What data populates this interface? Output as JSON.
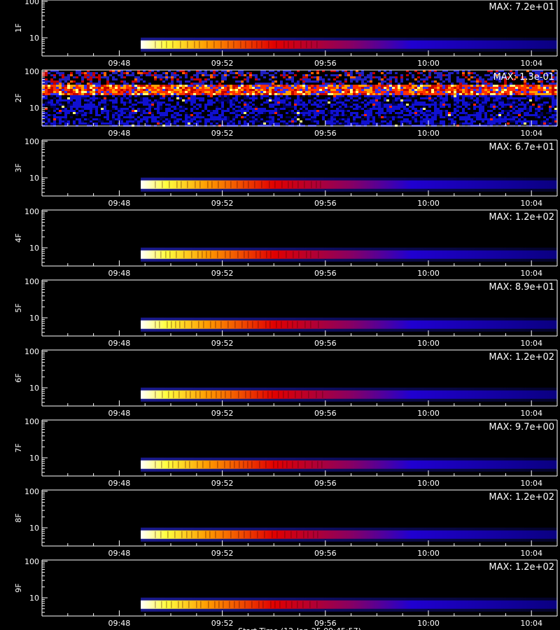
{
  "chart_data": {
    "type": "heatmap",
    "x_start": "09:45",
    "x_end": "10:05",
    "xticks": [
      "09:48",
      "09:52",
      "09:56",
      "10:00",
      "10:04"
    ],
    "y_scale": "log",
    "yticks": [
      "100",
      "10"
    ],
    "xlabel_partial": "Start Time (12-Jan-25 09:45:57)",
    "panels": [
      {
        "name": "1F",
        "max_label": "MAX: 7.2e+01",
        "max": 72,
        "onset": "09:48:50",
        "noisy": false
      },
      {
        "name": "2F",
        "max_label": "MAX: 1.3e-01",
        "max": 0.13,
        "onset": "09:45",
        "noisy": true
      },
      {
        "name": "3F",
        "max_label": "MAX: 6.7e+01",
        "max": 67,
        "onset": "09:48:50",
        "noisy": false
      },
      {
        "name": "4F",
        "max_label": "MAX: 1.2e+02",
        "max": 120,
        "onset": "09:48:50",
        "noisy": false
      },
      {
        "name": "5F",
        "max_label": "MAX: 8.9e+01",
        "max": 89,
        "onset": "09:48:50",
        "noisy": false
      },
      {
        "name": "6F",
        "max_label": "MAX: 1.2e+02",
        "max": 120,
        "onset": "09:48:50",
        "noisy": false
      },
      {
        "name": "7F",
        "max_label": "MAX: 9.7e+00",
        "max": 9.7,
        "onset": "09:48:50",
        "noisy": false
      },
      {
        "name": "8F",
        "max_label": "MAX: 1.2e+02",
        "max": 120,
        "onset": "09:48:50",
        "noisy": false
      },
      {
        "name": "9F",
        "max_label": "MAX: 1.2e+02",
        "max": 120,
        "onset": "09:48:50",
        "noisy": false
      }
    ]
  }
}
